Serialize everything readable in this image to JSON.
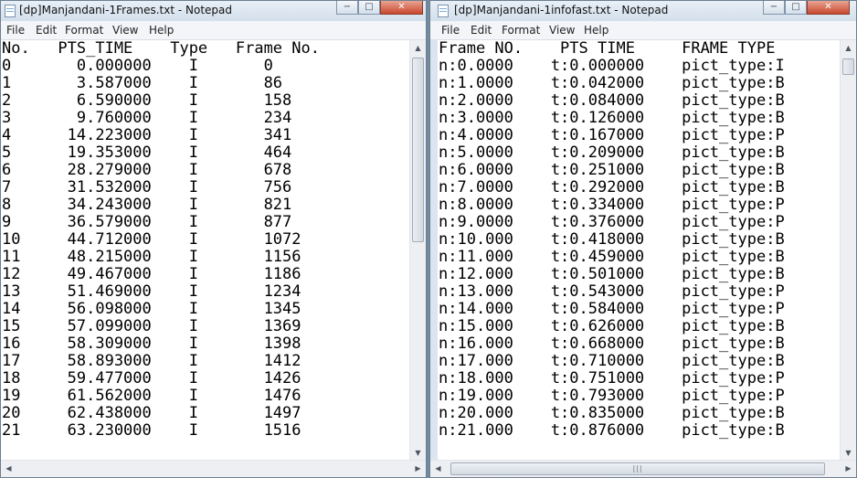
{
  "menu": [
    "File",
    "Edit",
    "Format",
    "View",
    "Help"
  ],
  "window_controls": [
    "−",
    "□",
    "✕"
  ],
  "left": {
    "title": "[dp]Manjandani-1Frames.txt - Notepad",
    "lines": [
      "No.   PTS_TIME    Type   Frame No.",
      "0       0.000000    I       0",
      "1       3.587000    I       86",
      "2       6.590000    I       158",
      "3       9.760000    I       234",
      "4      14.223000    I       341",
      "5      19.353000    I       464",
      "6      28.279000    I       678",
      "7      31.532000    I       756",
      "8      34.243000    I       821",
      "9      36.579000    I       877",
      "10     44.712000    I       1072",
      "11     48.215000    I       1156",
      "12     49.467000    I       1186",
      "13     51.469000    I       1234",
      "14     56.098000    I       1345",
      "15     57.099000    I       1369",
      "16     58.309000    I       1398",
      "17     58.893000    I       1412",
      "18     59.477000    I       1426",
      "19     61.562000    I       1476",
      "20     62.438000    I       1497",
      "21     63.230000    I       1516"
    ]
  },
  "right": {
    "title": "[dp]Manjandani-1infofast.txt - Notepad",
    "lines": [
      "Frame NO.    PTS TIME     FRAME TYPE",
      "n:0.0000    t:0.000000    pict_type:I",
      "n:1.0000    t:0.042000    pict_type:B",
      "n:2.0000    t:0.084000    pict_type:B",
      "n:3.0000    t:0.126000    pict_type:B",
      "n:4.0000    t:0.167000    pict_type:P",
      "n:5.0000    t:0.209000    pict_type:B",
      "n:6.0000    t:0.251000    pict_type:B",
      "n:7.0000    t:0.292000    pict_type:B",
      "n:8.0000    t:0.334000    pict_type:P",
      "n:9.0000    t:0.376000    pict_type:P",
      "n:10.000    t:0.418000    pict_type:B",
      "n:11.000    t:0.459000    pict_type:B",
      "n:12.000    t:0.501000    pict_type:B",
      "n:13.000    t:0.543000    pict_type:P",
      "n:14.000    t:0.584000    pict_type:P",
      "n:15.000    t:0.626000    pict_type:B",
      "n:16.000    t:0.668000    pict_type:B",
      "n:17.000    t:0.710000    pict_type:B",
      "n:18.000    t:0.751000    pict_type:P",
      "n:19.000    t:0.793000    pict_type:P",
      "n:20.000    t:0.835000    pict_type:B",
      "n:21.000    t:0.876000    pict_type:B"
    ]
  },
  "colors": {
    "accent": "#dbe5ef",
    "close_button": "#c9482e",
    "editor_bg": "#ffffff",
    "text": "#000000"
  }
}
